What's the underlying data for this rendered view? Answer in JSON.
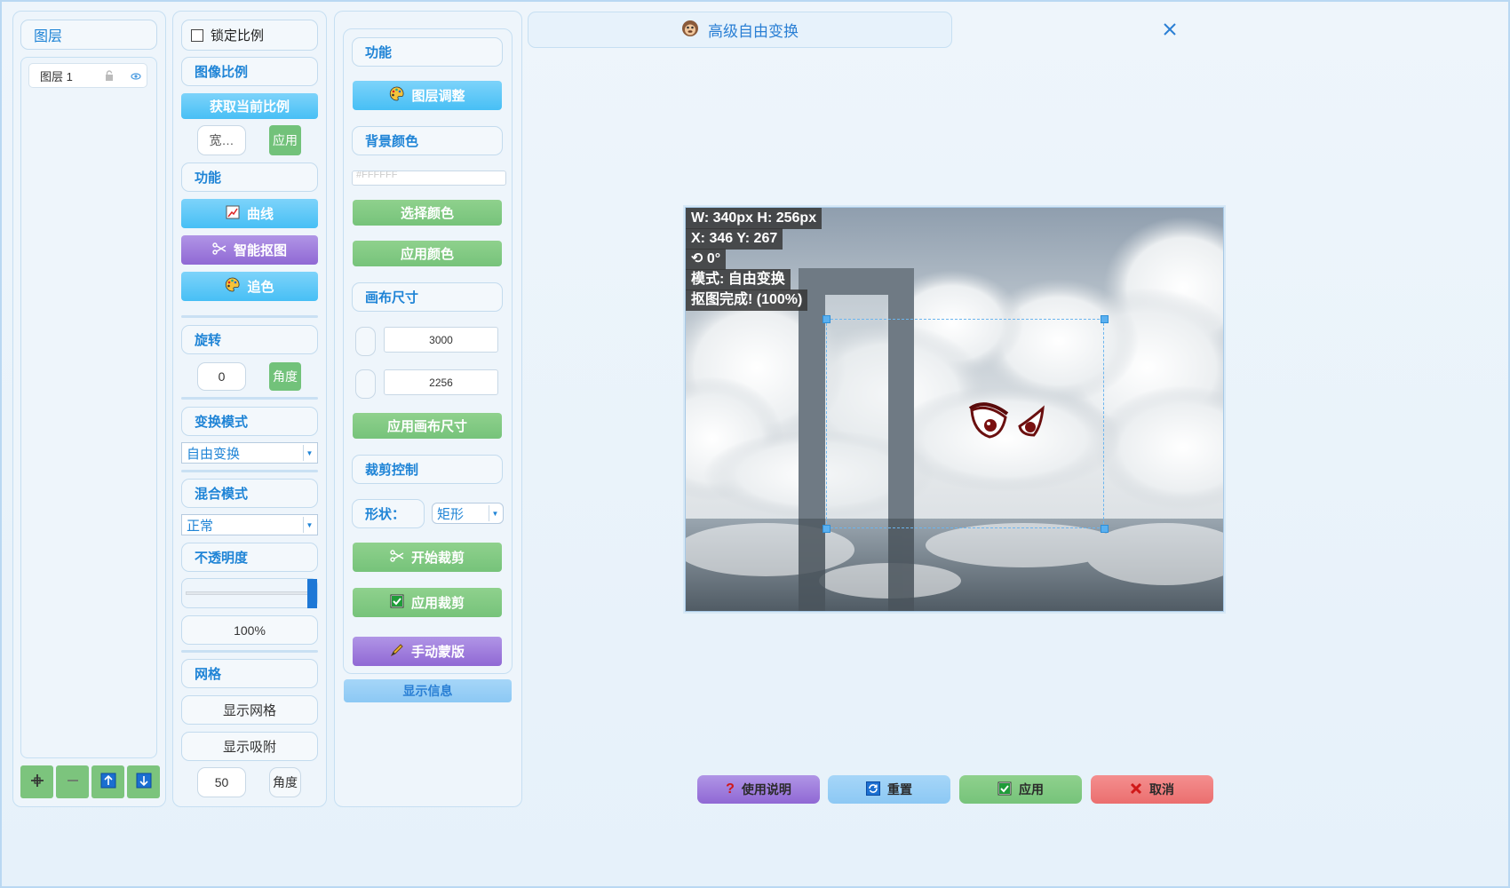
{
  "window": {
    "title": "高级自由变换",
    "title_icon": "monkey-face-icon",
    "close_icon": "close-icon"
  },
  "layers": {
    "header": "图层",
    "items": [
      {
        "name": "图层 1",
        "lock_icon": "lock-icon",
        "visible_icon": "eye-icon"
      }
    ],
    "bottom_buttons": [
      {
        "icon": "move-icon",
        "name": "move-layer-button"
      },
      {
        "icon": "minus-icon",
        "name": "remove-layer-button"
      },
      {
        "icon": "arrow-up-icon",
        "name": "layer-up-button"
      },
      {
        "icon": "arrow-down-icon",
        "name": "layer-down-button"
      }
    ]
  },
  "col2": {
    "lock_ratio": "锁定比例",
    "image_ratio": "图像比例",
    "get_ratio": "获取当前比例",
    "width_placeholder": "宽…",
    "apply_small": "应用",
    "function": "功能",
    "curve": "曲线",
    "smart_cutout": "智能抠图",
    "color_tracking": "追色",
    "rotate": "旋转",
    "rotate_value": "0",
    "angle_btn": "角度",
    "transform_mode": "变换模式",
    "transform_value": "自由变换",
    "blend_mode": "混合模式",
    "blend_value": "正常",
    "opacity": "不透明度",
    "opacity_value": "100%",
    "opacity_level": 1.0,
    "grid": "网格",
    "show_grid": "显示网格",
    "show_snap": "显示吸附",
    "grid_size": "50",
    "grid_btn": "角度"
  },
  "col3": {
    "function": "功能",
    "layer_adjust": "图层调整",
    "bg_color": "背景颜色",
    "bg_color_input": "#FFFFFF",
    "select_color": "选择颜色",
    "apply_color": "应用颜色",
    "canvas_size": "画布尺寸",
    "canvas_w": "3000",
    "canvas_h": "2256",
    "apply_canvas": "应用画布尺寸",
    "crop_control": "裁剪控制",
    "shape_label": "形状：",
    "shape_value": "矩形",
    "start_crop": "开始裁剪",
    "apply_crop": "应用裁剪",
    "manual_mask": "手动蒙版",
    "show_info": "显示信息"
  },
  "canvas_overlay": {
    "size": "W: 340px H: 256px",
    "pos": "X: 346 Y: 267",
    "rotation": "0°",
    "mode": "模式: 自由变换",
    "status": "抠图完成! (100%)"
  },
  "footer": {
    "help": "使用说明",
    "reset": "重置",
    "apply": "应用",
    "cancel": "取消"
  }
}
